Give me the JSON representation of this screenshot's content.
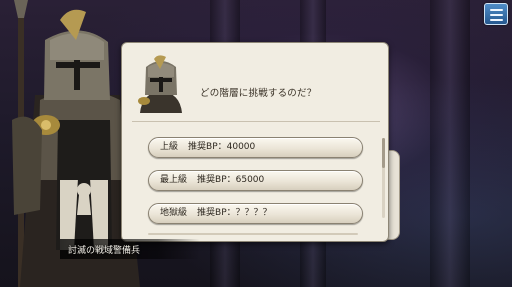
{
  "dialog": {
    "question": "どの階層に挑戦するのだ？",
    "options": [
      {
        "level": "上級",
        "bp": "推奨BP：40000"
      },
      {
        "level": "最上級",
        "bp": "推奨BP：65000"
      },
      {
        "level": "地獄級",
        "bp": "推奨BP：？？？？"
      }
    ]
  },
  "speaker": {
    "name": "討滅の戦域警備兵"
  },
  "icons": {
    "menu": "hamburger-menu-icon",
    "portrait": "knight-portrait"
  },
  "colors": {
    "panel": "#f1ede2",
    "menu_button": "#3a73ad"
  }
}
